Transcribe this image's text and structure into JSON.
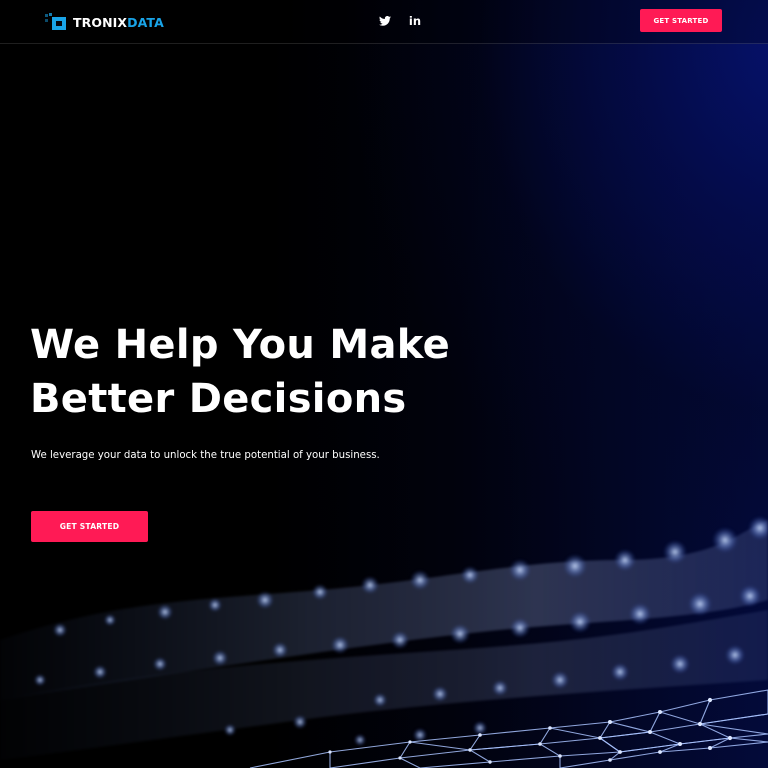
{
  "brand": {
    "name_part1": "TRONIX",
    "name_part2": "DATA",
    "logo_icon": "tronixdata-logo-mark"
  },
  "nav": {
    "social": [
      {
        "name": "twitter",
        "icon": "twitter-icon"
      },
      {
        "name": "linkedin",
        "icon": "linkedin-icon",
        "glyph": "in"
      }
    ],
    "cta_label": "GET STARTED"
  },
  "hero": {
    "title_line1": "We Help You Make",
    "title_line2": "Better Decisions",
    "subtitle": "We leverage your data to unlock the true potential of your business.",
    "cta_label": "GET STARTED"
  },
  "colors": {
    "accent": "#ff1a55",
    "brand_blue": "#19a4e8",
    "background": "#000000",
    "glow": "#06126e"
  }
}
